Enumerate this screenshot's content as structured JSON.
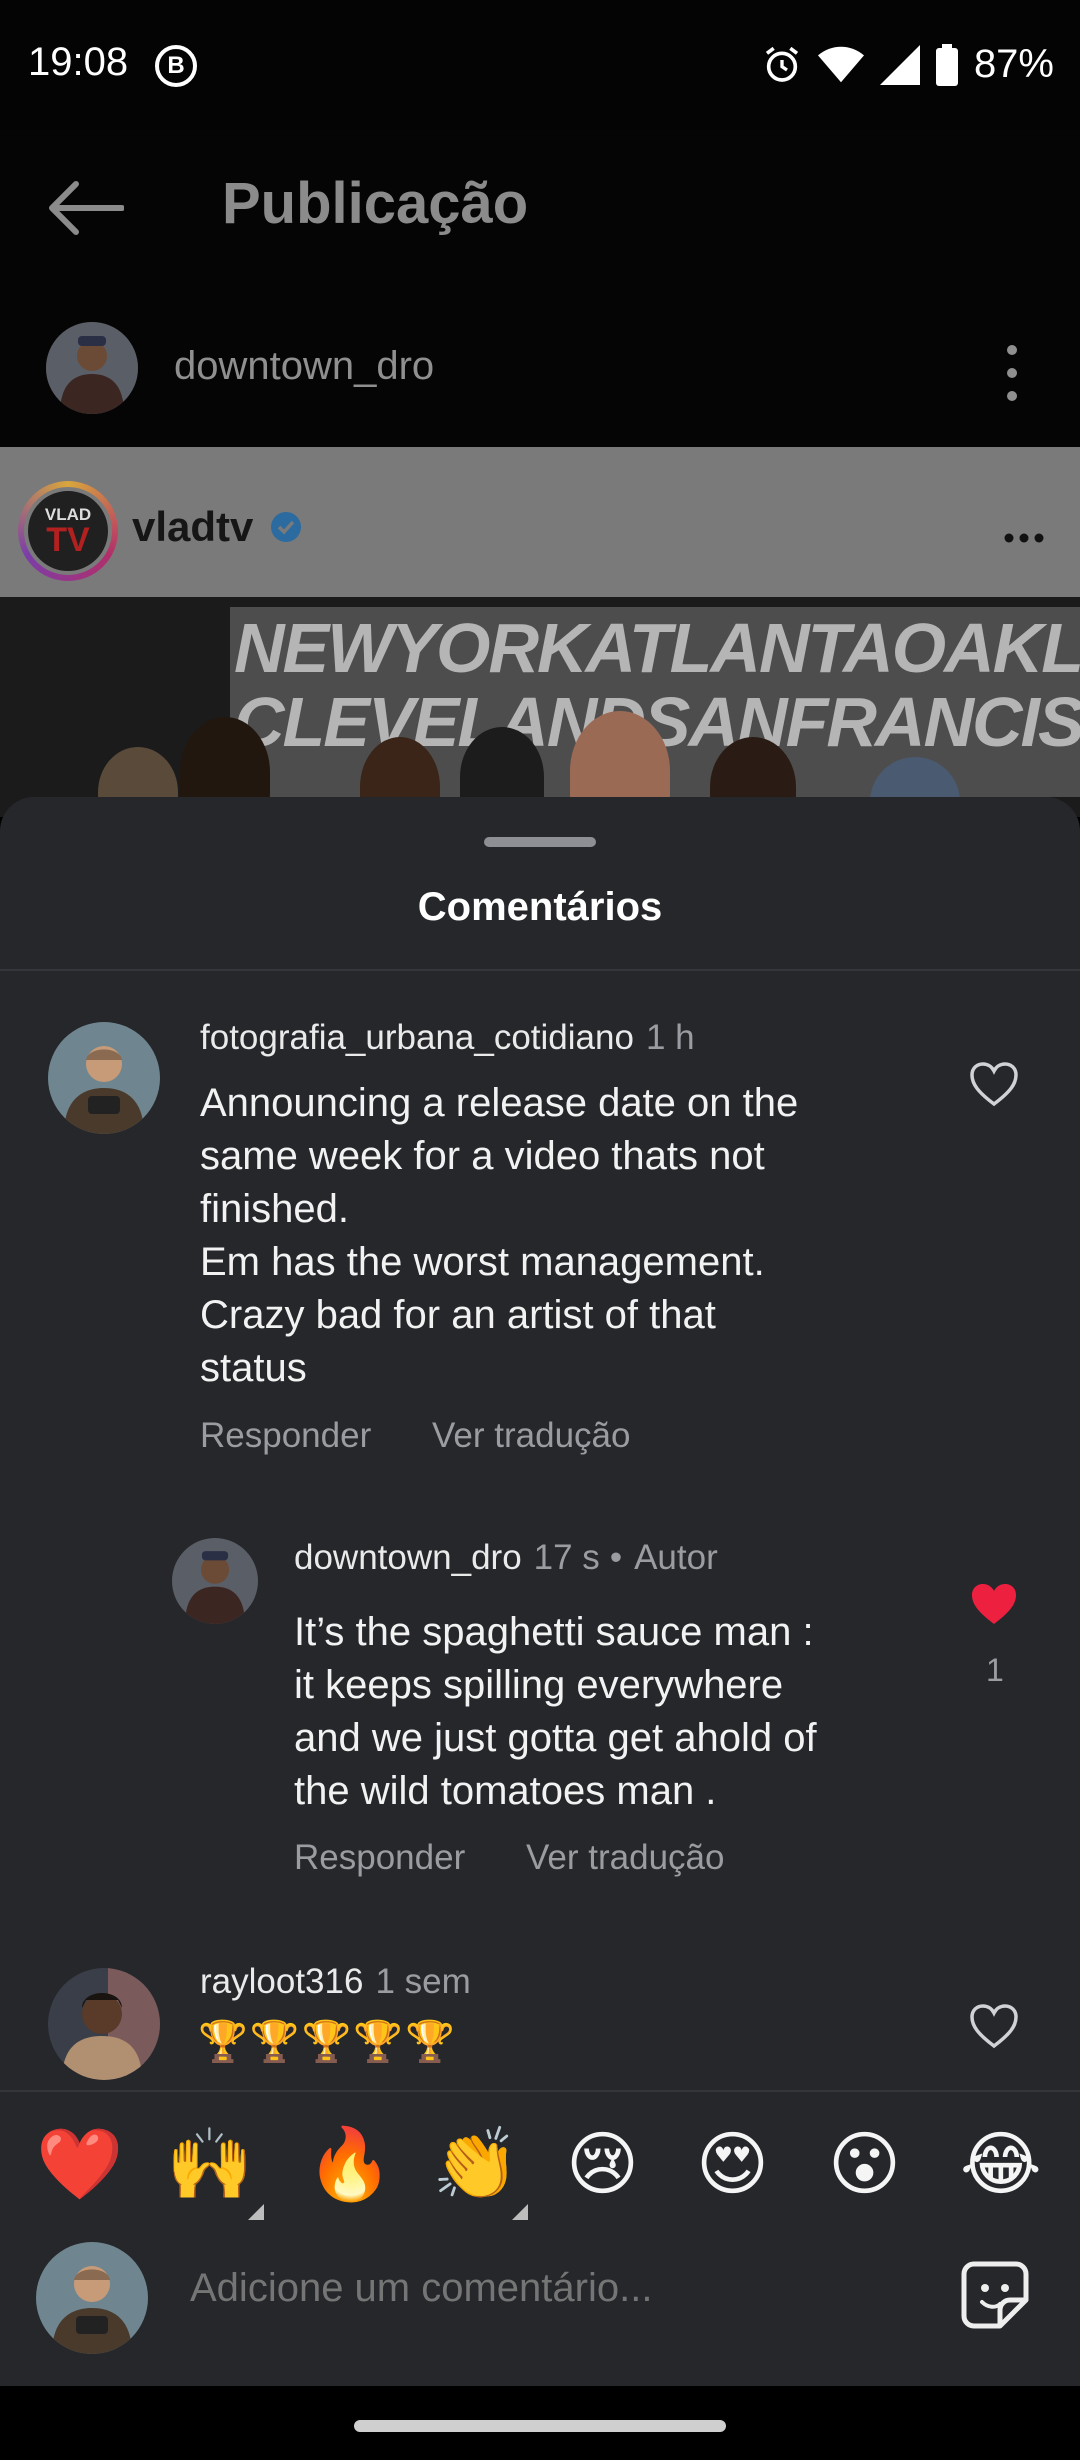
{
  "status_bar": {
    "time": "19:08",
    "app_badge": "B",
    "battery": "87%"
  },
  "header": {
    "title": "Publicação",
    "author": "downtown_dro"
  },
  "post": {
    "account": "vladtv",
    "avatar_line1": "VLAD",
    "avatar_line2": "TV",
    "banner_text": [
      "NEWYORKATLANTAOAKLAND",
      "CLEVELANDSANFRANCISCO"
    ]
  },
  "comments_sheet": {
    "title": "Comentários",
    "comments": [
      {
        "user": "fotografia_urbana_cotidiano",
        "time": "1 h",
        "lines": [
          "Announcing a release date on the",
          "same week for a video thats not",
          "finished.",
          "Em has the worst management.",
          "Crazy bad for an artist of that",
          "status"
        ],
        "reply_label": "Responder",
        "translate_label": "Ver tradução",
        "liked": false
      },
      {
        "user": "downtown_dro",
        "time": "17 s",
        "author_tag": "Autor",
        "lines": [
          "It’s the spaghetti sauce man :",
          "it keeps spilling everywhere",
          "and we just gotta get ahold of",
          "the wild tomatoes man ."
        ],
        "reply_label": "Responder",
        "translate_label": "Ver tradução",
        "liked": true,
        "like_count": "1"
      },
      {
        "user": "rayloot316",
        "time": "1 sem",
        "text": "🏆🏆🏆🏆🏆",
        "liked": false
      }
    ]
  },
  "emoji_bar": [
    "❤️",
    "🙌",
    "🔥",
    "👏",
    "😢",
    "😍",
    "😮",
    "😂"
  ],
  "composer": {
    "placeholder": "Adicione um comentário..."
  },
  "colors": {
    "sheet_bg": "#25272b",
    "liked_heart": "#ed2040",
    "secondary_text": "#9a9ca1"
  }
}
